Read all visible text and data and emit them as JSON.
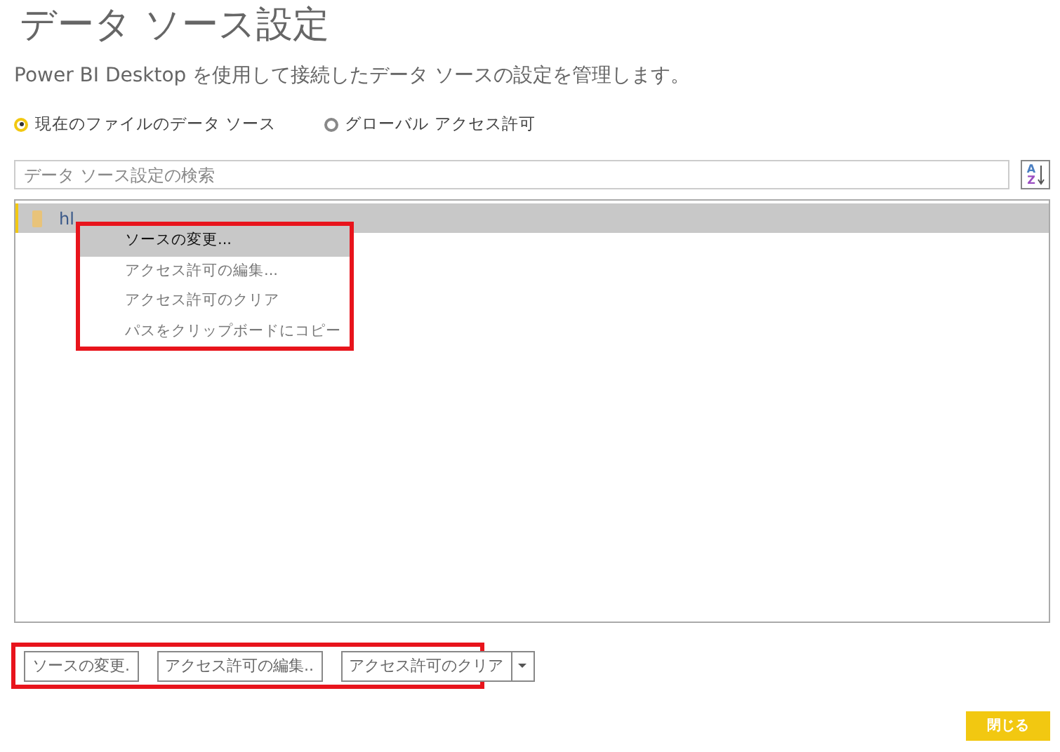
{
  "title": "データ ソース設定",
  "description": "Power BI Desktop を使用して接続したデータ ソースの設定を管理します。",
  "scope_options": [
    {
      "label": "現在のファイルのデータ ソース",
      "selected": true
    },
    {
      "label": "グローバル アクセス許可",
      "selected": false
    }
  ],
  "search": {
    "placeholder": "データ ソース設定の検索"
  },
  "sort_button": {
    "top": "A",
    "bottom": "Z"
  },
  "sources": [
    {
      "label": "hl",
      "selected": true
    }
  ],
  "context_menu": [
    {
      "label": "ソースの変更...",
      "selected": true
    },
    {
      "label": "アクセス許可の編集...",
      "selected": false
    },
    {
      "label": "アクセス許可のクリア",
      "selected": false
    },
    {
      "label": "パスをクリップボードにコピー",
      "selected": false
    }
  ],
  "buttons": [
    {
      "label": "ソースの変更.",
      "kind": "plain"
    },
    {
      "label": "アクセス許可の編集..",
      "kind": "plain"
    },
    {
      "label": "アクセス許可のクリア",
      "kind": "split"
    }
  ],
  "close_button": "閉じる"
}
